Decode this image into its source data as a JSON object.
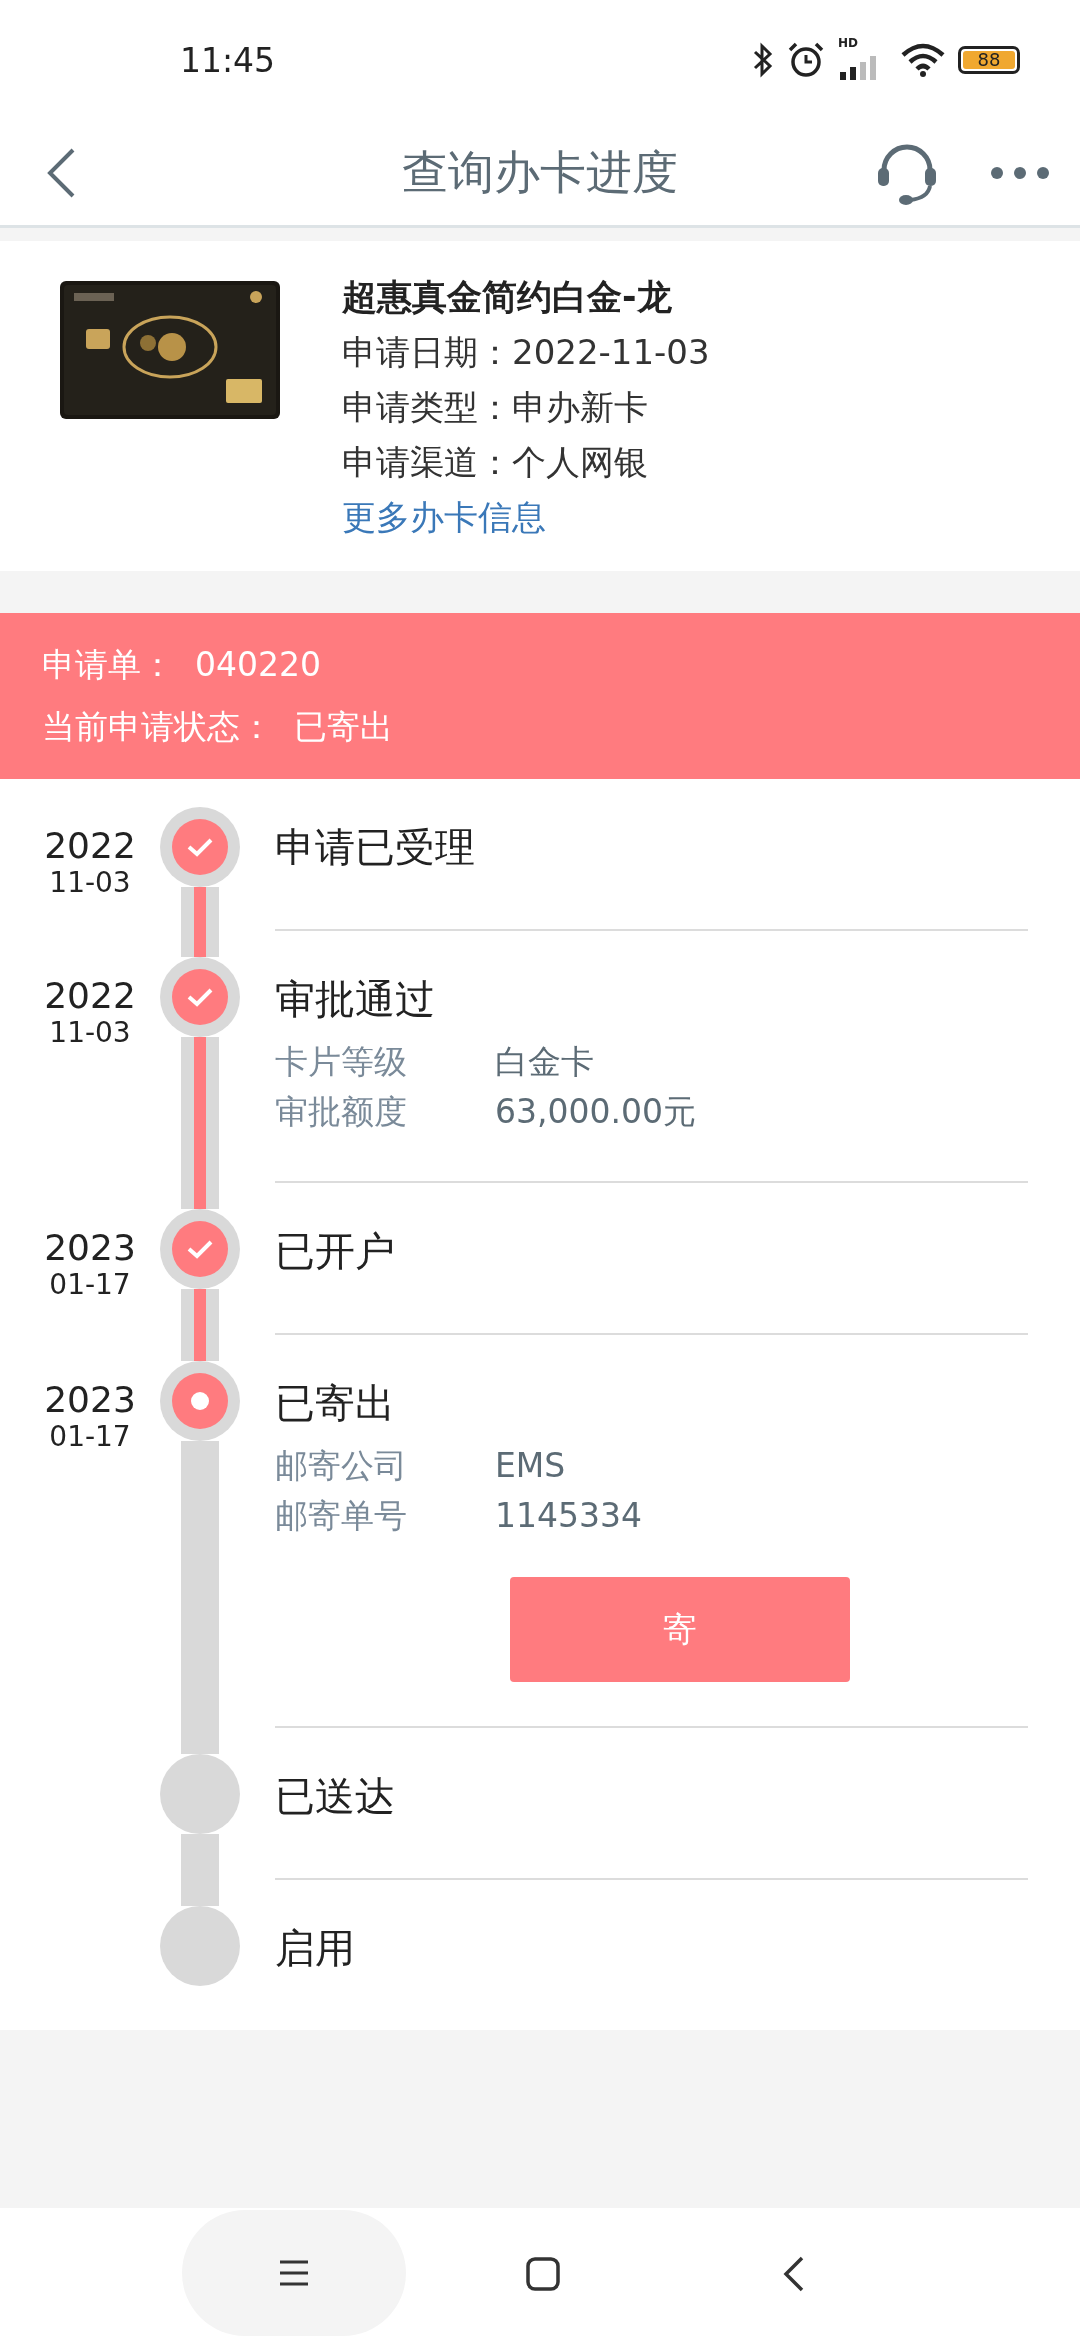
{
  "status_bar": {
    "time": "11:45",
    "network": "HD",
    "battery": "88"
  },
  "header": {
    "title": "查询办卡进度"
  },
  "card": {
    "name": "超惠真金简约白金-龙",
    "fields": [
      {
        "label": "申请日期：",
        "value": "2022-11-03"
      },
      {
        "label": "申请类型：",
        "value": "申办新卡"
      },
      {
        "label": "申请渠道：",
        "value": "个人网银"
      }
    ],
    "link": "更多办卡信息"
  },
  "application": {
    "number_label": "申请单：",
    "number": "040220",
    "status_label": "当前申请状态：",
    "status": "已寄出"
  },
  "steps": [
    {
      "year": "2022",
      "date": "11-03",
      "title": "申请已受理",
      "kind": "done"
    },
    {
      "year": "2022",
      "date": "11-03",
      "title": "审批通过",
      "kind": "done",
      "details": [
        {
          "label": "卡片等级",
          "value": "白金卡"
        },
        {
          "label": "审批额度",
          "value": "63,000.00元"
        }
      ]
    },
    {
      "year": "2023",
      "date": "01-17",
      "title": "已开户",
      "kind": "done"
    },
    {
      "year": "2023",
      "date": "01-17",
      "title": "已寄出",
      "kind": "current",
      "details": [
        {
          "label": "邮寄公司",
          "value": "EMS"
        },
        {
          "label": "邮寄单号",
          "value": "1145334"
        }
      ],
      "button": "寄"
    },
    {
      "title": "已送达",
      "kind": "pending"
    },
    {
      "title": "启用",
      "kind": "pending"
    }
  ]
}
